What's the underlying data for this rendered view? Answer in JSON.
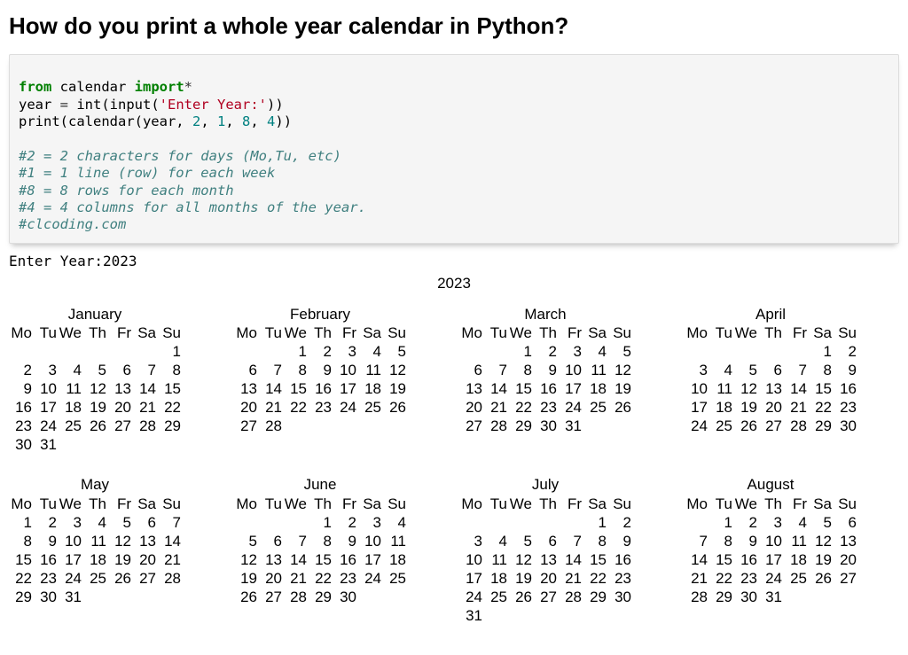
{
  "heading": "How do you print a whole year calendar in Python?",
  "code": {
    "l1": {
      "a": "from",
      "b": " calendar ",
      "c": "import",
      "d": "*"
    },
    "l2": {
      "a": "year ",
      "b": "=",
      "c": " int(input(",
      "d": "'Enter Year:'",
      "e": "))"
    },
    "l3": {
      "a": "print(calendar(year, ",
      "n1": "2",
      "c1": ", ",
      "n2": "1",
      "c2": ", ",
      "n3": "8",
      "c3": ", ",
      "n4": "4",
      "e": "))"
    },
    "cmt1": "#2 = 2 characters for days (Mo,Tu, etc)",
    "cmt2": "#1 = 1 line (row) for each week",
    "cmt3": "#8 = 8 rows for each month",
    "cmt4": "#4 = 4 columns for all months of the year.",
    "cmt5": "#clcoding.com"
  },
  "prompt_line": "Enter Year:2023",
  "calendar": {
    "year_label": "2023",
    "dow": [
      "Mo",
      "Tu",
      "We",
      "Th",
      "Fr",
      "Sa",
      "Su"
    ],
    "months": [
      {
        "name": "January",
        "lead": 6,
        "days": 31
      },
      {
        "name": "February",
        "lead": 2,
        "days": 28
      },
      {
        "name": "March",
        "lead": 2,
        "days": 31
      },
      {
        "name": "April",
        "lead": 5,
        "days": 30
      },
      {
        "name": "May",
        "lead": 0,
        "days": 31
      },
      {
        "name": "June",
        "lead": 3,
        "days": 30
      },
      {
        "name": "July",
        "lead": 5,
        "days": 31
      },
      {
        "name": "August",
        "lead": 1,
        "days": 31
      }
    ]
  }
}
